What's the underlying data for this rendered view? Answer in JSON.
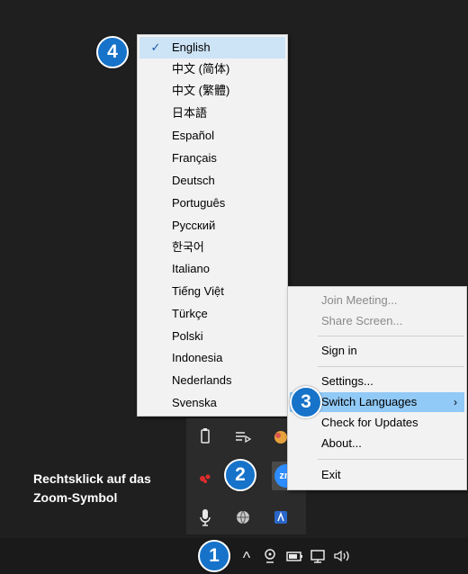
{
  "language_menu": {
    "items": [
      {
        "label": "English",
        "checked": true
      },
      {
        "label": "中文 (简体)"
      },
      {
        "label": "中文 (繁體)"
      },
      {
        "label": "日本語"
      },
      {
        "label": "Español"
      },
      {
        "label": "Français"
      },
      {
        "label": "Deutsch"
      },
      {
        "label": "Português"
      },
      {
        "label": "Русский"
      },
      {
        "label": "한국어"
      },
      {
        "label": "Italiano"
      },
      {
        "label": "Tiếng Việt"
      },
      {
        "label": "Türkçe"
      },
      {
        "label": "Polski"
      },
      {
        "label": "Indonesia"
      },
      {
        "label": "Nederlands"
      },
      {
        "label": "Svenska"
      }
    ],
    "check_glyph": "✓"
  },
  "context_menu": {
    "join_meeting": "Join Meeting...",
    "share_screen": "Share Screen...",
    "sign_in": "Sign in",
    "settings": "Settings...",
    "switch_languages": "Switch Languages",
    "submenu_arrow": "›",
    "check_updates": "Check for Updates",
    "about": "About...",
    "exit": "Exit"
  },
  "badges": {
    "one": "1",
    "two": "2",
    "three": "3",
    "four": "4"
  },
  "caption": {
    "line1": "Rechtsklick auf das",
    "line2": "Zoom-Symbol"
  },
  "tray": {
    "zoom_label": "zm"
  },
  "taskbar": {
    "chevron": "^"
  },
  "colors": {
    "badge": "#1673c9",
    "highlight": "#91c9f7",
    "zoom": "#2d8cff"
  }
}
